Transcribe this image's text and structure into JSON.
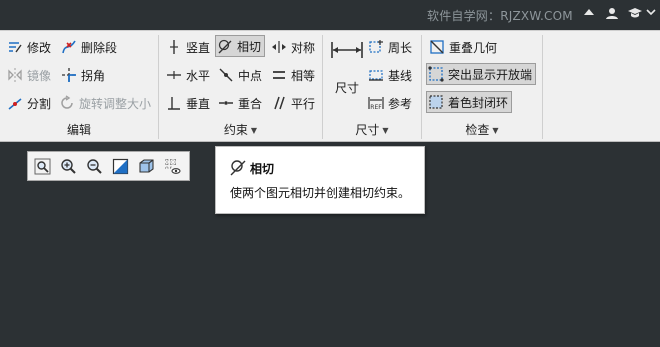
{
  "watermark": "软件自学网：RJZXW.COM",
  "title_icons": [
    "up-arrow-icon",
    "person-icon",
    "graduation-cap-icon"
  ],
  "groups": {
    "edit": {
      "label": "编辑",
      "modify": "修改",
      "delete_segment": "删除段",
      "mirror": "镜像",
      "corner": "拐角",
      "divide": "分割",
      "rotate_resize": "旋转调整大小"
    },
    "constrain": {
      "label": "约束",
      "vertical": "竖直",
      "tangent": "相切",
      "symmetric": "对称",
      "horizontal": "水平",
      "midpoint": "中点",
      "equal": "相等",
      "perpendicular": "垂直",
      "coincident": "重合",
      "parallel": "平行"
    },
    "dimension": {
      "label": "尺寸",
      "dimension": "尺寸",
      "perimeter": "周长",
      "baseline": "基线",
      "reference": "参考"
    },
    "inspect": {
      "label": "检查",
      "overlap_geometry": "重叠几何",
      "highlight_open_ends": "突出显示开放端",
      "shade_closed_loops": "着色封闭环"
    }
  },
  "view_toolbar": [
    "refit-icon",
    "zoom-in-icon",
    "zoom-out-icon",
    "repaint-icon",
    "display-style-icon",
    "sketch-display-icon"
  ],
  "tooltip": {
    "title": "相切",
    "description": "使两个图元相切并创建相切约束。"
  },
  "colors": {
    "background": "#2c3134",
    "ribbon": "#f0f0f0",
    "icon_blue": "#1f6fc4"
  }
}
